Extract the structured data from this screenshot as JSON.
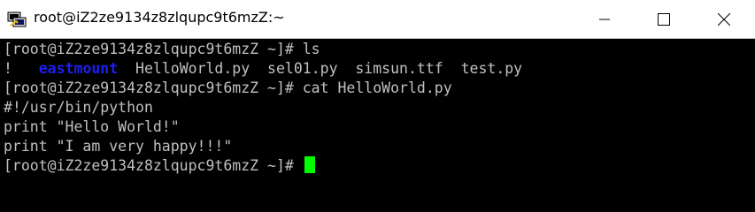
{
  "window": {
    "title": "root@iZ2ze9134z8zlqupc9t6mzZ:~"
  },
  "icons": {
    "app": "putty-terminal-icon",
    "minimize": "minimize-icon",
    "maximize": "maximize-icon",
    "close": "close-icon"
  },
  "terminal": {
    "line1": "[root@iZ2ze9134z8zlqupc9t6mzZ ~]# ls",
    "ls_output": {
      "bang": "!",
      "dir": "eastmount",
      "files": "HelloWorld.py  sel01.py  simsun.ttf  test.py"
    },
    "line3": "[root@iZ2ze9134z8zlqupc9t6mzZ ~]# cat HelloWorld.py",
    "line4": "#!/usr/bin/python",
    "line5": "print \"Hello World!\"",
    "line6": "print \"I am very happy!!!\"",
    "line7_prompt": "[root@iZ2ze9134z8zlqupc9t6mzZ ~]# "
  },
  "colors": {
    "text": "#c0c0c0",
    "directory": "#1e1ef0",
    "cursor": "#00ff00",
    "background": "#000000"
  }
}
